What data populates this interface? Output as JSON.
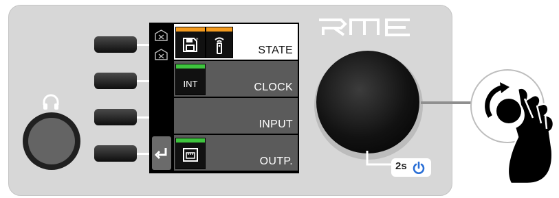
{
  "device": {
    "brand": "RME",
    "brand_color": "#ffffff",
    "panel_color": "#d7d7d7"
  },
  "display": {
    "rows": [
      {
        "label": "STATE",
        "selected": true,
        "tiles": [
          "save-icon",
          "remote-icon"
        ],
        "tile_bar_color": "#f39a1e"
      },
      {
        "label": "CLOCK",
        "selected": false,
        "tiles": [
          "INT"
        ],
        "tile_bar_color": "#3ec43e"
      },
      {
        "label": "INPUT",
        "selected": false,
        "tiles": []
      },
      {
        "label": "OUTP.",
        "selected": false,
        "tiles": [
          "network-icon"
        ],
        "tile_bar_color": "#3ec43e"
      }
    ],
    "sidebar_icons": [
      "disabled-box-icon",
      "disabled-box-icon",
      "back-arrow-icon"
    ]
  },
  "knob": {
    "hold_label": "2s",
    "power_icon": "power-icon"
  },
  "gesture": {
    "icon": "hand-rotate-knob-icon"
  }
}
